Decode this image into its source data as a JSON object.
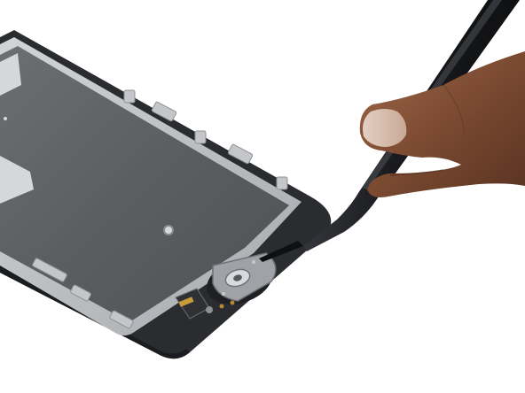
{
  "image": {
    "subject": "phone-display-assembly-home-button-repair",
    "background_color": "#ffffff",
    "colors": {
      "bezel": "#2b2c30",
      "shield_plate": "#5d5f63",
      "shield_frame": "#b9bbbe",
      "tweezers": "#1c1d20",
      "skin": "#7a4a32",
      "bracket": "#9fa2a6"
    }
  }
}
